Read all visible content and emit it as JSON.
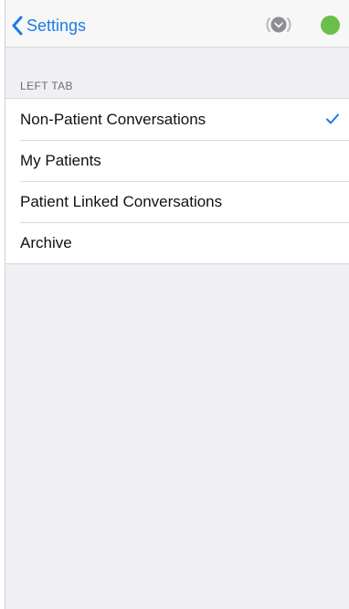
{
  "navbar": {
    "back_label": "Settings",
    "back_icon": "chevron-left-icon",
    "status_icon": "shield-badge-icon",
    "presence_color": "#6cbe4a"
  },
  "section": {
    "header": "LEFT TAB"
  },
  "options": [
    {
      "label": "Non-Patient Conversations",
      "selected": true
    },
    {
      "label": "My Patients",
      "selected": false
    },
    {
      "label": "Patient Linked Conversations",
      "selected": false
    },
    {
      "label": "Archive",
      "selected": false
    }
  ],
  "colors": {
    "accent": "#1f7ae6",
    "background": "#efeff4"
  }
}
